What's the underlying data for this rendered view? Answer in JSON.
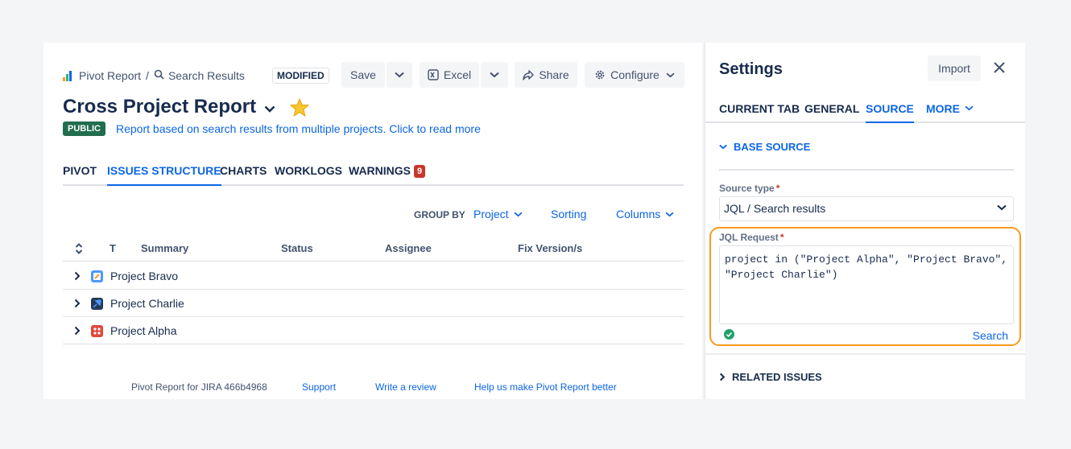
{
  "breadcrumb": {
    "app": "Pivot Report",
    "separator": "/",
    "page": "Search Results"
  },
  "status_badge": "MODIFIED",
  "toolbar": {
    "save": "Save",
    "excel": "Excel",
    "share": "Share",
    "configure": "Configure"
  },
  "report": {
    "title": "Cross Project Report",
    "visibility": "PUBLIC",
    "description": "Report based on search results from multiple projects. Click to read more"
  },
  "tabs": [
    "PIVOT",
    "ISSUES STRUCTURE",
    "CHARTS",
    "WORKLOGS",
    "WARNINGS"
  ],
  "warnings_count": "9",
  "controls": {
    "group_by_label": "GROUP BY",
    "group_by_value": "Project",
    "sorting": "Sorting",
    "columns": "Columns"
  },
  "table": {
    "headers": {
      "type": "T",
      "summary": "Summary",
      "status": "Status",
      "assignee": "Assignee",
      "fix_version": "Fix Version/s"
    },
    "rows": [
      {
        "name": "Project Bravo",
        "icon": "project-bravo-icon",
        "color": "#4c9aff"
      },
      {
        "name": "Project Charlie",
        "icon": "project-charlie-icon",
        "color": "#253858"
      },
      {
        "name": "Project Alpha",
        "icon": "project-alpha-icon",
        "color": "#e2483d"
      }
    ]
  },
  "footer": {
    "version": "Pivot Report for JIRA 466b4968",
    "support": "Support",
    "review": "Write a review",
    "feedback": "Help us make Pivot Report better"
  },
  "settings": {
    "title": "Settings",
    "import": "Import",
    "tabs": {
      "current": "CURRENT TAB",
      "general": "GENERAL",
      "source": "SOURCE",
      "more": "MORE"
    },
    "base_source": "BASE SOURCE",
    "source_type_label": "Source type",
    "source_type_value": "JQL / Search results",
    "jql_label": "JQL Request",
    "required_mark": "*",
    "jql_value": "project in (\"Project Alpha\", \"Project Bravo\",\n\"Project Charlie\")",
    "search": "Search",
    "related_issues": "RELATED ISSUES"
  },
  "colors": {
    "accent": "#0c66e4",
    "highlight": "#f79a1f",
    "public_badge": "#216e4e",
    "warning_badge": "#c9372c"
  }
}
